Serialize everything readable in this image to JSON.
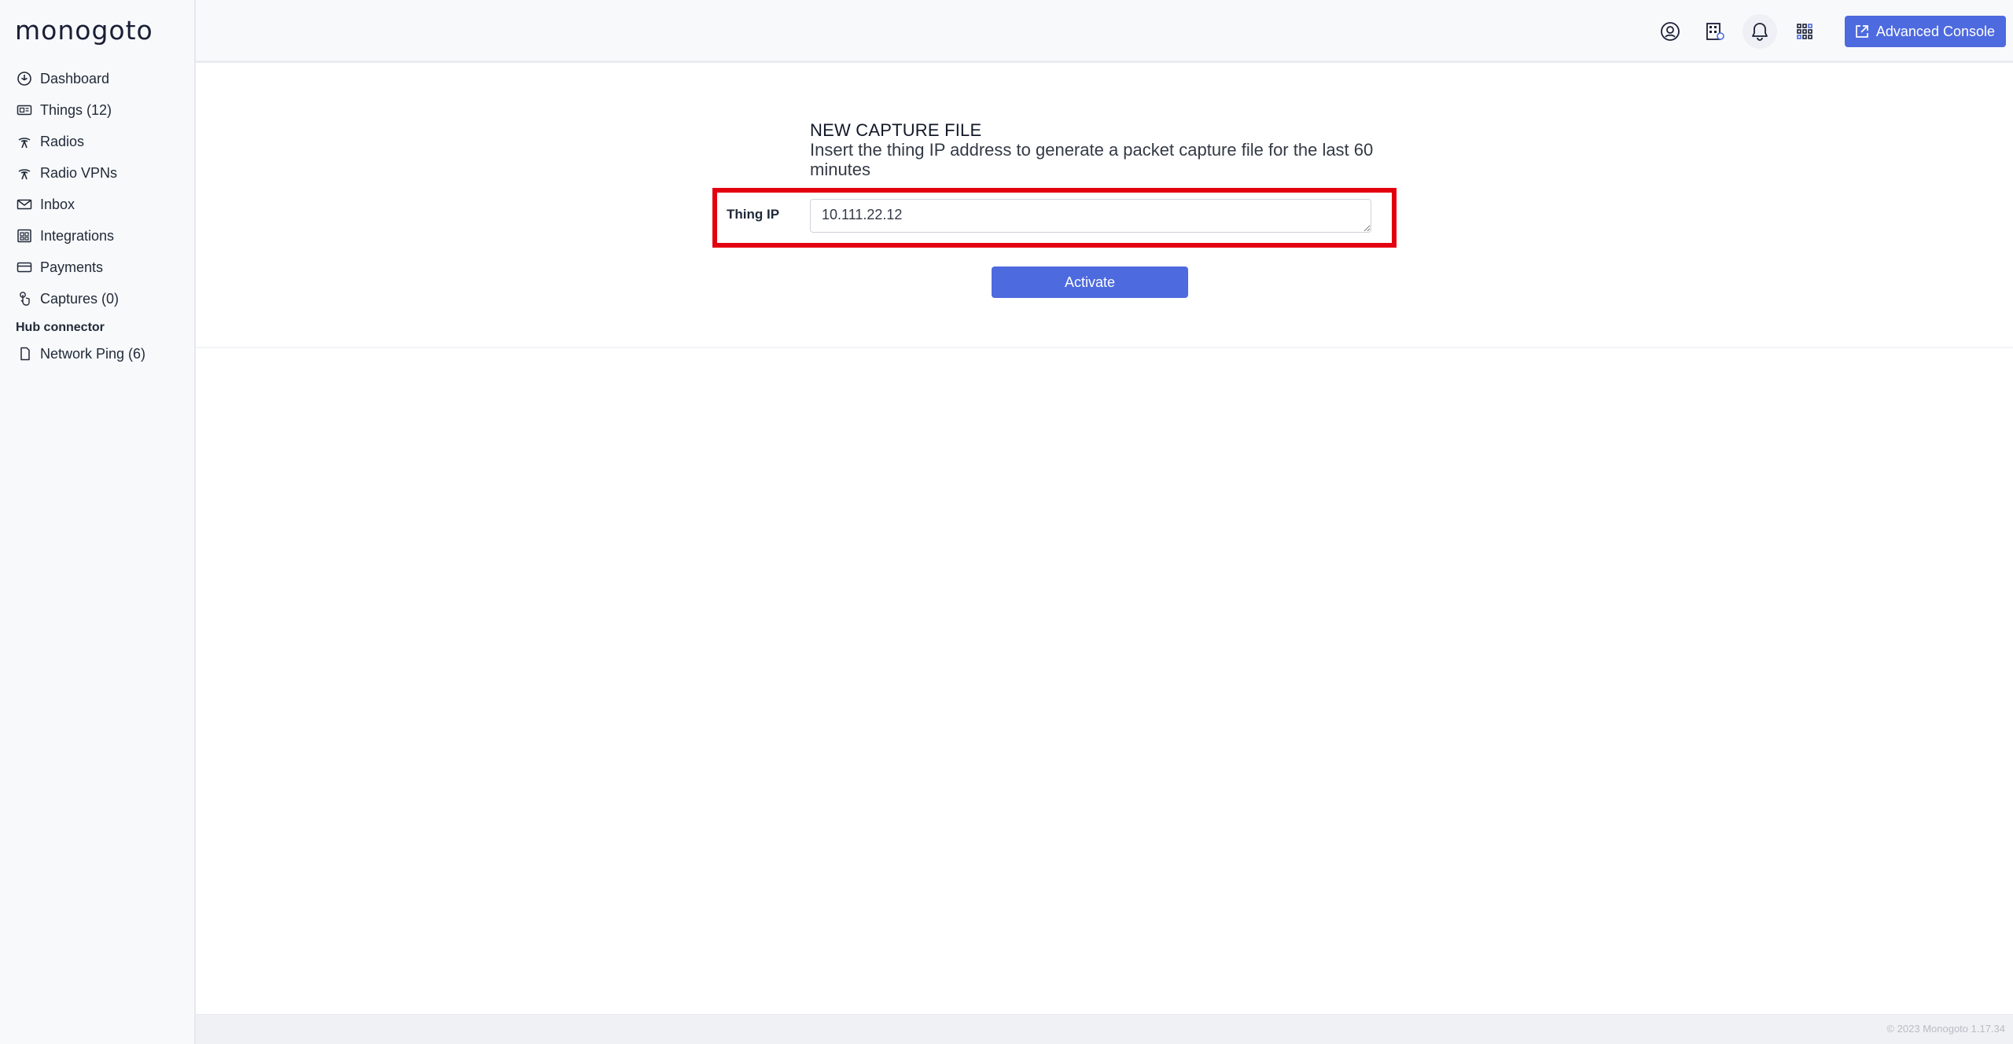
{
  "app": {
    "logo_text": "monogoto"
  },
  "sidebar": {
    "items": [
      {
        "label": "Dashboard",
        "icon": "dashboard-icon"
      },
      {
        "label": "Things (12)",
        "icon": "sim-card-icon"
      },
      {
        "label": "Radios",
        "icon": "radio-antenna-icon"
      },
      {
        "label": "Radio VPNs",
        "icon": "radio-antenna-icon"
      },
      {
        "label": "Inbox",
        "icon": "envelope-icon"
      },
      {
        "label": "Integrations",
        "icon": "integrations-icon"
      },
      {
        "label": "Payments",
        "icon": "credit-card-icon"
      },
      {
        "label": "Captures (0)",
        "icon": "capture-touch-icon"
      }
    ],
    "section_title": "Hub connector",
    "section_items": [
      {
        "label": "Network Ping (6)",
        "icon": "sim-icon"
      }
    ]
  },
  "header": {
    "icons": [
      "user-circle-icon",
      "organization-icon",
      "bell-icon",
      "apps-grid-icon"
    ],
    "advanced_console_label": "Advanced Console"
  },
  "form": {
    "title": "NEW CAPTURE FILE",
    "description": "Insert the thing IP address to generate a packet capture file for the last 60 minutes",
    "field_label": "Thing IP",
    "field_value": "10.111.22.12",
    "submit_label": "Activate"
  },
  "colors": {
    "accent": "#4d6ade",
    "highlight": "#e3000f"
  },
  "footer": {
    "text": "© 2023 Monogoto 1.17.34"
  }
}
